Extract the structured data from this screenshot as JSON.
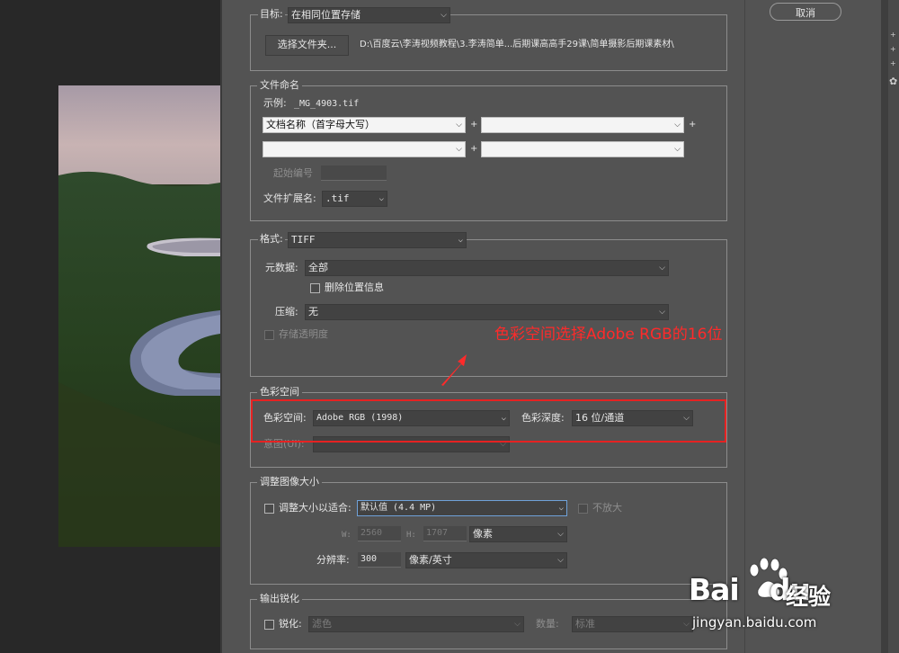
{
  "cancel_label": "取消",
  "target": {
    "label": "目标:",
    "value": "在相同位置存储",
    "choose_folder": "选择文件夹...",
    "path": "D:\\百度云\\李涛视频教程\\3.李涛简单...后期课高高手29课\\简单摄影后期课素材\\"
  },
  "naming": {
    "legend": "文件命名",
    "example_label": "示例:",
    "example_value": "_MG_4903.tif",
    "field1": "文档名称（首字母大写）",
    "field2": "",
    "field3": "",
    "field4": "",
    "plus": "+",
    "start_number_label": "起始编号",
    "extension_label": "文件扩展名:",
    "extension_value": ".tif"
  },
  "format": {
    "label": "格式:",
    "value": "TIFF",
    "metadata_label": "元数据:",
    "metadata_value": "全部",
    "remove_location": "删除位置信息",
    "compression_label": "压缩:",
    "compression_value": "无",
    "save_transparency": "存储透明度"
  },
  "annotation": "色彩空间选择Adobe RGB的16位",
  "color_space": {
    "legend": "色彩空间",
    "space_label": "色彩空间:",
    "space_value": "Adobe RGB (1998)",
    "depth_label": "色彩深度:",
    "depth_value": "16 位/通道",
    "intent_label": "意图(UI):",
    "intent_value": ""
  },
  "resize": {
    "legend": "调整图像大小",
    "fit_label": "调整大小以适合:",
    "fit_value": "默认值 (4.4 MP)",
    "no_enlarge": "不放大",
    "w_label": "W:",
    "w_value": "2560",
    "h_label": "H:",
    "h_value": "1707",
    "unit_value": "像素",
    "resolution_label": "分辨率:",
    "resolution_value": "300",
    "resolution_unit": "像素/英寸"
  },
  "sharpen": {
    "legend": "输出锐化",
    "label": "锐化:",
    "value": "滤色",
    "amount_label": "数量:",
    "amount_value": "标准"
  },
  "watermark": {
    "brand": "Bai",
    "brand2": "du",
    "jingyan": "经验",
    "url": "jingyan.baidu.com"
  },
  "colors": {
    "dialog": "#535353",
    "highlight": "#e62222",
    "annotation": "#ff2a2a"
  }
}
